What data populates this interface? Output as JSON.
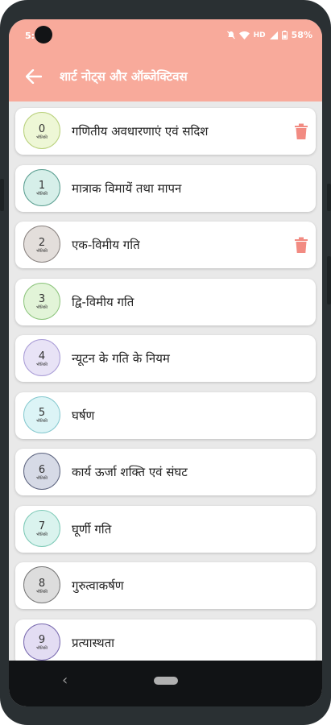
{
  "status": {
    "time": "5:",
    "network": "HD",
    "battery": "58%"
  },
  "appbar": {
    "title": "शार्ट नोट्स और ऑब्जेक्टिवस"
  },
  "colors": {
    "accent": "#f8aa9b",
    "delete": "#f28b82"
  },
  "items": [
    {
      "num": "0",
      "sub": "भौतिकी",
      "title": "गणितीय अवधारणाएं एवं सदिश",
      "badge_bg": "#eef7d6",
      "badge_border": "#b8d07a",
      "delete": true
    },
    {
      "num": "1",
      "sub": "भौतिकी",
      "title": "मात्राक विमायें तथा मापन",
      "badge_bg": "#d6efe9",
      "badge_border": "#5a9e90",
      "delete": false
    },
    {
      "num": "2",
      "sub": "भौतिकी",
      "title": "एक-विमीय गति",
      "badge_bg": "#e3dedb",
      "badge_border": "#8a8380",
      "delete": true
    },
    {
      "num": "3",
      "sub": "भौतिकी",
      "title": "द्वि-विमीय गति",
      "badge_bg": "#e2f4d8",
      "badge_border": "#8cc47c",
      "delete": false
    },
    {
      "num": "4",
      "sub": "भौतिकी",
      "title": "न्यूटन के गति के नियम",
      "badge_bg": "#e8e3f6",
      "badge_border": "#a99cd6",
      "delete": false
    },
    {
      "num": "5",
      "sub": "भौतिकी",
      "title": "घर्षण",
      "badge_bg": "#dcf4f6",
      "badge_border": "#86c9cf",
      "delete": false
    },
    {
      "num": "6",
      "sub": "भौतिकी",
      "title": "कार्य ऊर्जा शक्ति एवं संघट",
      "badge_bg": "#d6dae6",
      "badge_border": "#5e6580",
      "delete": false
    },
    {
      "num": "7",
      "sub": "भौतिकी",
      "title": "घूर्णी गति",
      "badge_bg": "#daf3ee",
      "badge_border": "#7cc9b6",
      "delete": false
    },
    {
      "num": "8",
      "sub": "भौतिकी",
      "title": "गुरुत्वाकर्षण",
      "badge_bg": "#dddddd",
      "badge_border": "#777777",
      "delete": false
    },
    {
      "num": "9",
      "sub": "भौतिकी",
      "title": "प्रत्यास्थता",
      "badge_bg": "#e3ddf3",
      "badge_border": "#7a6bb0",
      "delete": false
    }
  ]
}
